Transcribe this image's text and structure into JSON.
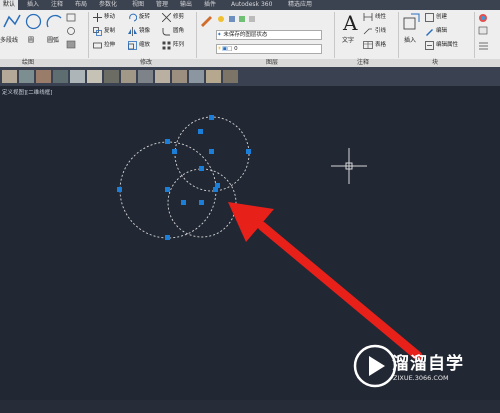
{
  "tabs": [
    "默认",
    "插入",
    "注释",
    "布局",
    "参数化",
    "视图",
    "管理",
    "输出",
    "插件",
    "Autodesk 360",
    "精选应用"
  ],
  "draw": {
    "polyline": "多段线",
    "circle": "圆",
    "arc": "圆弧"
  },
  "modify": {
    "move": "移动",
    "rotate": "旋转",
    "trim": "修剪",
    "copy": "复制",
    "mirror": "镜像",
    "fillet": "圆角",
    "stretch": "拉伸",
    "scale": "缩放",
    "array": "阵列"
  },
  "layer": {
    "state": "未保存的图层状态",
    "current": "0"
  },
  "annotation": {
    "text": "文字",
    "linear": "线性",
    "leader": "引线",
    "table": "表格"
  },
  "block": {
    "insert": "插入",
    "create": "创建",
    "edit": "编辑",
    "attribute": "编辑属性"
  },
  "panels": {
    "draw": "绘图",
    "modify": "修改",
    "layer": "图层",
    "annotation": "注释",
    "block": "块"
  },
  "viewport": {
    "label": "定义视图][二维线框]"
  },
  "swatches": [
    "#b4a899",
    "#7c8e8f",
    "#9a7c6a",
    "#5e6d70",
    "#adb5b8",
    "#c7c2b6",
    "#6b6c64",
    "#a29888",
    "#7e8289",
    "#b9b0a1",
    "#9d8f80",
    "#8b96a0",
    "#b6a78f",
    "#7d7468"
  ],
  "logo": {
    "title": "溜溜自学",
    "sub": "ZIXUE.3066.COM"
  },
  "colors": {
    "accent": "#e8201a",
    "grip": "#1c7ed6",
    "circle": "#d8d8d8"
  }
}
